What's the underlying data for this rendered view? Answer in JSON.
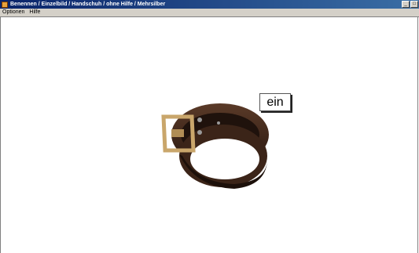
{
  "window": {
    "title": "Benennen / Einzelbild / Handschuh / ohne Hilfe / Mehrsilber",
    "app_icon": "app-icon",
    "controls": [
      "minimize-icon",
      "maximize-icon"
    ]
  },
  "menu": {
    "items": [
      "Optionen",
      "Hilfe"
    ]
  },
  "content": {
    "image": "belt-image",
    "word": "ein"
  },
  "colors": {
    "titlebar_start": "#0a246a",
    "titlebar_end": "#3a6ea5",
    "belt_leather": "#3b2418",
    "buckle": "#c9a66b"
  }
}
